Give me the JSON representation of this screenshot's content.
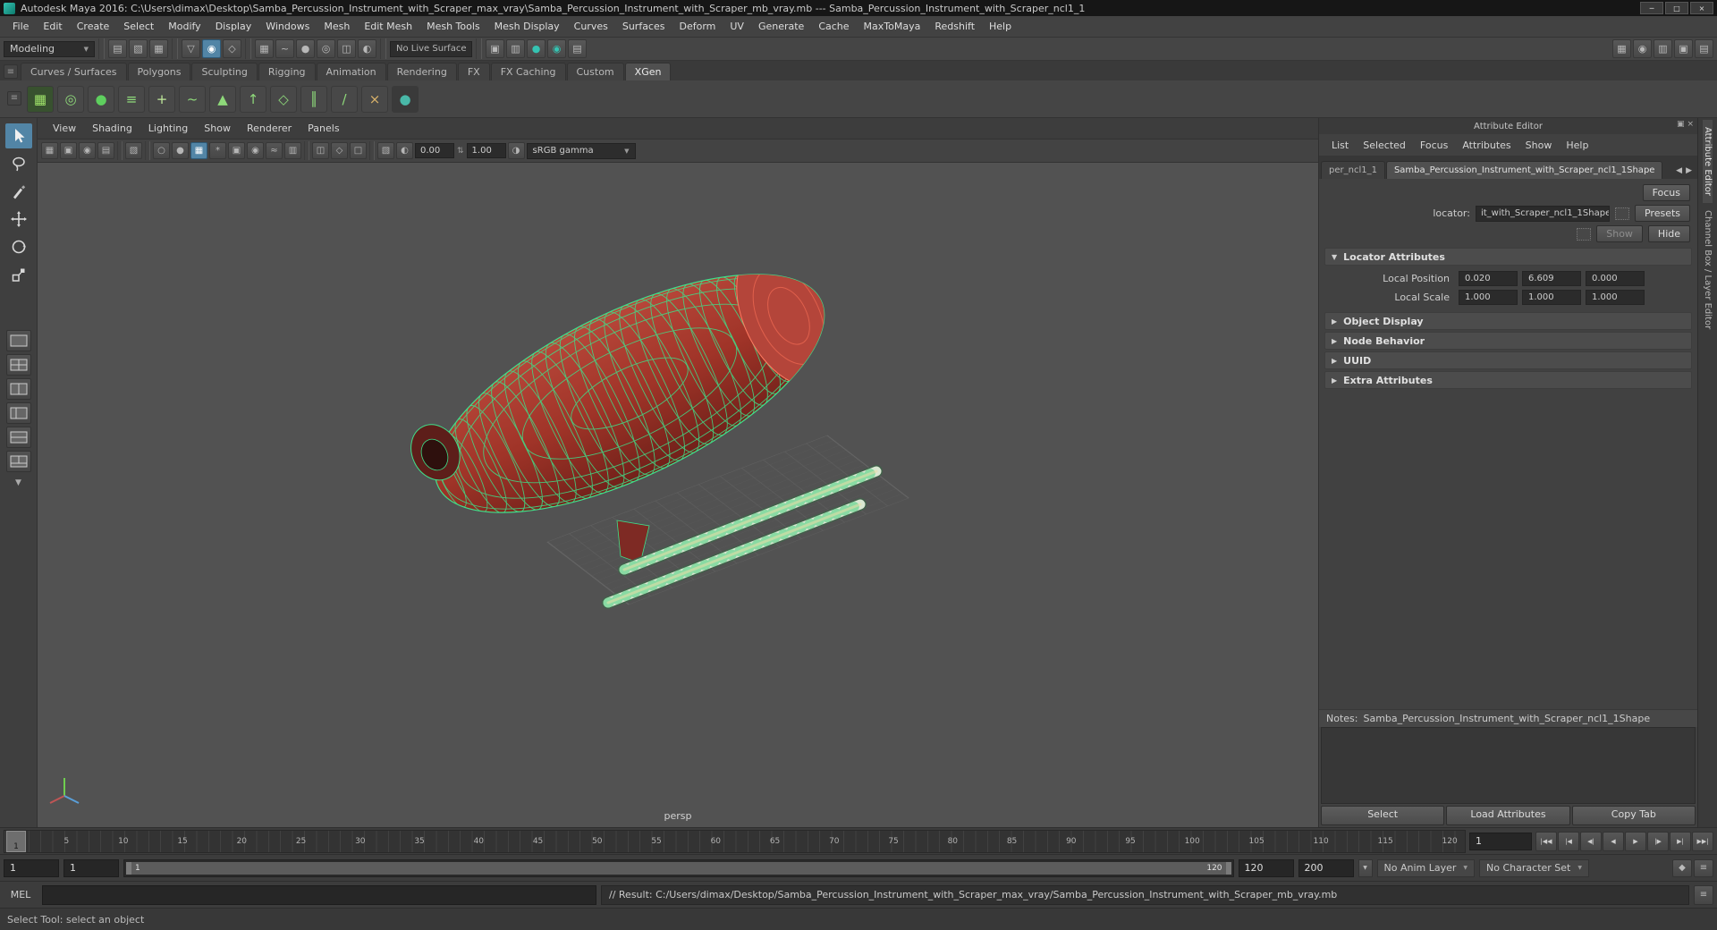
{
  "icons": {
    "dropdown": "▼",
    "expanded": "▼",
    "collapsed": "▶",
    "tab_prev": "◀",
    "tab_next": "▶",
    "minimize": "─",
    "maximize": "□",
    "close": "×",
    "menu": "≡",
    "float": "▣",
    "spin": "⇅"
  },
  "window": {
    "title": "Autodesk Maya 2016: C:\\Users\\dimax\\Desktop\\Samba_Percussion_Instrument_with_Scraper_max_vray\\Samba_Percussion_Instrument_with_Scraper_mb_vray.mb  ---  Samba_Percussion_Instrument_with_Scraper_ncl1_1"
  },
  "menu_bar": [
    "File",
    "Edit",
    "Create",
    "Select",
    "Modify",
    "Display",
    "Windows",
    "Mesh",
    "Edit Mesh",
    "Mesh Tools",
    "Mesh Display",
    "Curves",
    "Surfaces",
    "Deform",
    "UV",
    "Generate",
    "Cache",
    "MaxToMaya",
    "Redshift",
    "Help"
  ],
  "status_line": {
    "menu_set": "Modeling",
    "live_surface": "No Live Surface",
    "icons_left": [
      {
        "type": "divider"
      },
      {
        "name": "new-scene-icon",
        "glyph": "▤"
      },
      {
        "name": "open-scene-icon",
        "glyph": "▧"
      },
      {
        "name": "save-scene-icon",
        "glyph": "▦"
      },
      {
        "type": "divider"
      },
      {
        "name": "select-hierarchy-icon",
        "glyph": "▽"
      },
      {
        "name": "select-object-icon",
        "glyph": "◉",
        "active": true
      },
      {
        "name": "select-component-icon",
        "glyph": "◇"
      },
      {
        "type": "divider"
      },
      {
        "name": "snap-grid-icon",
        "glyph": "▦"
      },
      {
        "name": "snap-curve-icon",
        "glyph": "~"
      },
      {
        "name": "snap-point-icon",
        "glyph": "●"
      },
      {
        "name": "snap-projected-center-icon",
        "glyph": "◎"
      },
      {
        "name": "snap-view-plane-icon",
        "glyph": "◫"
      },
      {
        "name": "make-live-icon",
        "glyph": "◐"
      },
      {
        "type": "divider"
      }
    ],
    "icons_right": [
      {
        "type": "divider"
      },
      {
        "name": "construction-history-icon",
        "glyph": "▣"
      },
      {
        "name": "open-render-view-icon",
        "glyph": "▥"
      },
      {
        "name": "render-current-frame-icon",
        "glyph": "●",
        "fg": "#35c3b2"
      },
      {
        "name": "ipr-render-icon",
        "glyph": "◉",
        "fg": "#35c3b2"
      },
      {
        "name": "render-settings-icon",
        "glyph": "▤"
      }
    ],
    "icons_sidebar": [
      {
        "name": "modeling-toolkit-icon",
        "glyph": "▦"
      },
      {
        "name": "humanik-icon",
        "glyph": "◉"
      },
      {
        "name": "attribute-editor-toggle-icon",
        "glyph": "▥"
      },
      {
        "name": "tool-settings-icon",
        "glyph": "▣"
      },
      {
        "name": "channel-box-icon",
        "glyph": "▤"
      }
    ]
  },
  "shelf": {
    "tabs": [
      {
        "label": "Curves / Surfaces"
      },
      {
        "label": "Polygons"
      },
      {
        "label": "Sculpting"
      },
      {
        "label": "Rigging"
      },
      {
        "label": "Animation"
      },
      {
        "label": "Rendering"
      },
      {
        "label": "FX"
      },
      {
        "label": "FX Caching"
      },
      {
        "label": "Custom"
      },
      {
        "label": "XGen",
        "active": true
      }
    ],
    "items": [
      {
        "name": "xgen-open-editor-icon",
        "glyph": "▦",
        "bg": "#38512f",
        "fg": "#9fe36a"
      },
      {
        "name": "xgen-create-description-icon",
        "glyph": "◎",
        "bg": "#484848",
        "fg": "#8ed97a"
      },
      {
        "name": "xgen-preview-sphere-icon",
        "glyph": "●",
        "bg": "#484848",
        "fg": "#5ecf5e"
      },
      {
        "name": "xgen-comb-icon",
        "glyph": "≡",
        "bg": "#484848",
        "fg": "#8ed97a"
      },
      {
        "name": "xgen-add-guide-icon",
        "glyph": "+",
        "bg": "#484848",
        "fg": "#bfe99a"
      },
      {
        "name": "xgen-curves-icon",
        "glyph": "~",
        "bg": "#484848",
        "fg": "#8ed97a"
      },
      {
        "name": "xgen-density-icon",
        "glyph": "▲",
        "bg": "#484848",
        "fg": "#8ed97a"
      },
      {
        "name": "xgen-length-icon",
        "glyph": "↑",
        "bg": "#484848",
        "fg": "#8ed97a"
      },
      {
        "name": "xgen-width-icon",
        "glyph": "◇",
        "bg": "#484848",
        "fg": "#8ed97a"
      },
      {
        "name": "xgen-clump-icon",
        "glyph": "║",
        "bg": "#484848",
        "fg": "#8ed97a"
      },
      {
        "name": "xgen-cut-icon",
        "glyph": "/",
        "bg": "#484848",
        "fg": "#8ed97a"
      },
      {
        "name": "xgen-delete-icon",
        "glyph": "×",
        "bg": "#484848",
        "fg": "#d9b26a"
      },
      {
        "name": "plugin-shelf-icon",
        "glyph": "●",
        "bg": "#3a3a3a",
        "fg": "#49b8a8"
      }
    ]
  },
  "toolbox": {
    "tools": [
      "select-tool",
      "lasso-select-tool",
      "paint-select-tool",
      "move-tool",
      "rotate-tool",
      "scale-tool"
    ],
    "layouts": [
      "single-pane-layout",
      "two-pane-layout",
      "four-pane-layout",
      "outliner-persp-layout",
      "split-pane-layout",
      "persp-graph-layout"
    ]
  },
  "viewport": {
    "menus": [
      "View",
      "Shading",
      "Lighting",
      "Show",
      "Renderer",
      "Panels"
    ],
    "toolbar": [
      {
        "name": "select-camera-icon",
        "glyph": "▦"
      },
      {
        "name": "lock-camera-icon",
        "glyph": "▣"
      },
      {
        "name": "camera-attributes-icon",
        "glyph": "◉"
      },
      {
        "name": "bookmark-icon",
        "glyph": "▤"
      },
      {
        "type": "divider"
      },
      {
        "name": "image-plane-icon",
        "glyph": "▧"
      },
      {
        "type": "divider"
      },
      {
        "name": "wireframe-icon",
        "glyph": "○"
      },
      {
        "name": "shaded-icon",
        "glyph": "●"
      },
      {
        "name": "textured-icon",
        "glyph": "▦",
        "active": true
      },
      {
        "name": "lights-icon",
        "glyph": "*"
      },
      {
        "name": "shadows-icon",
        "glyph": "▣"
      },
      {
        "name": "ambient-occlusion-icon",
        "glyph": "◉"
      },
      {
        "name": "motion-blur-icon",
        "glyph": "≈"
      },
      {
        "name": "multisample-icon",
        "glyph": "▥"
      },
      {
        "type": "divider"
      },
      {
        "name": "xray-icon",
        "glyph": "◫"
      },
      {
        "name": "xray-joints-icon",
        "glyph": "◇"
      },
      {
        "name": "isolate-select-icon",
        "glyph": "□"
      },
      {
        "type": "divider"
      },
      {
        "name": "grease-pencil-icon",
        "glyph": "▧"
      }
    ],
    "exposure_icon": "◐",
    "exposure": "0.00",
    "gamma_icon": "◑",
    "gamma": "1.00",
    "color_space": "sRGB gamma",
    "camera": "persp"
  },
  "attribute_editor": {
    "panel_title": "Attribute Editor",
    "menus": [
      "List",
      "Selected",
      "Focus",
      "Attributes",
      "Show",
      "Help"
    ],
    "tabs": [
      {
        "label": "per_ncl1_1"
      },
      {
        "label": "Samba_Percussion_Instrument_with_Scraper_ncl1_1Shape",
        "active": true
      }
    ],
    "focus_button": "Focus",
    "presets_button": "Presets",
    "show_button": "Show",
    "hide_button": "Hide",
    "locator_label": "locator:",
    "locator_value": "it_with_Scraper_ncl1_1Shape",
    "locator_attributes": {
      "label": "Locator Attributes",
      "rows": [
        {
          "label": "Local Position",
          "v1": "0.020",
          "v2": "6.609",
          "v3": "0.000"
        },
        {
          "label": "Local Scale",
          "v1": "1.000",
          "v2": "1.000",
          "v3": "1.000"
        }
      ]
    },
    "collapsed_sections": [
      "Object Display",
      "Node Behavior",
      "UUID",
      "Extra Attributes"
    ],
    "notes_label": "Notes:",
    "notes_value": "Samba_Percussion_Instrument_with_Scraper_ncl1_1Shape",
    "buttons": [
      "Select",
      "Load Attributes",
      "Copy Tab"
    ]
  },
  "side_tabs": {
    "attribute_editor": "Attribute Editor",
    "channel_box": "Channel Box / Layer Editor"
  },
  "time_slider": {
    "ticks": [
      "1",
      "5",
      "10",
      "15",
      "20",
      "25",
      "30",
      "35",
      "40",
      "45",
      "50",
      "55",
      "60",
      "65",
      "70",
      "75",
      "80",
      "85",
      "90",
      "95",
      "100",
      "105",
      "110",
      "115",
      "120"
    ],
    "current_frame": "1",
    "frame_field": "1",
    "playback": [
      {
        "name": "go-to-start-button",
        "glyph": "|◀◀"
      },
      {
        "name": "step-back-frame-button",
        "glyph": "|◀"
      },
      {
        "name": "step-back-key-button",
        "glyph": "◀|"
      },
      {
        "name": "play-backwards-button",
        "glyph": "◀"
      },
      {
        "name": "play-forwards-button",
        "glyph": "▶"
      },
      {
        "name": "step-forward-key-button",
        "glyph": "|▶"
      },
      {
        "name": "step-forward-frame-button",
        "glyph": "▶|"
      },
      {
        "name": "go-to-end-button",
        "glyph": "▶▶|"
      }
    ]
  },
  "range_slider": {
    "animation_start": "1",
    "playback_start": "1",
    "bar_start": "1",
    "bar_end": "120",
    "playback_end": "120",
    "animation_end": "200",
    "anim_layer": "No Anim Layer",
    "character_set": "No Character Set"
  },
  "command_line": {
    "label": "MEL",
    "result": "// Result: C:/Users/dimax/Desktop/Samba_Percussion_Instrument_with_Scraper_max_vray/Samba_Percussion_Instrument_with_Scraper_mb_vray.mb"
  },
  "help_line": {
    "text": "Select Tool: select an object"
  },
  "colors": {
    "selection_blue": "#5285a6",
    "wireframe_green": "#3fe08a",
    "body_red": "#a93a32",
    "teal": "#35c3b2"
  }
}
